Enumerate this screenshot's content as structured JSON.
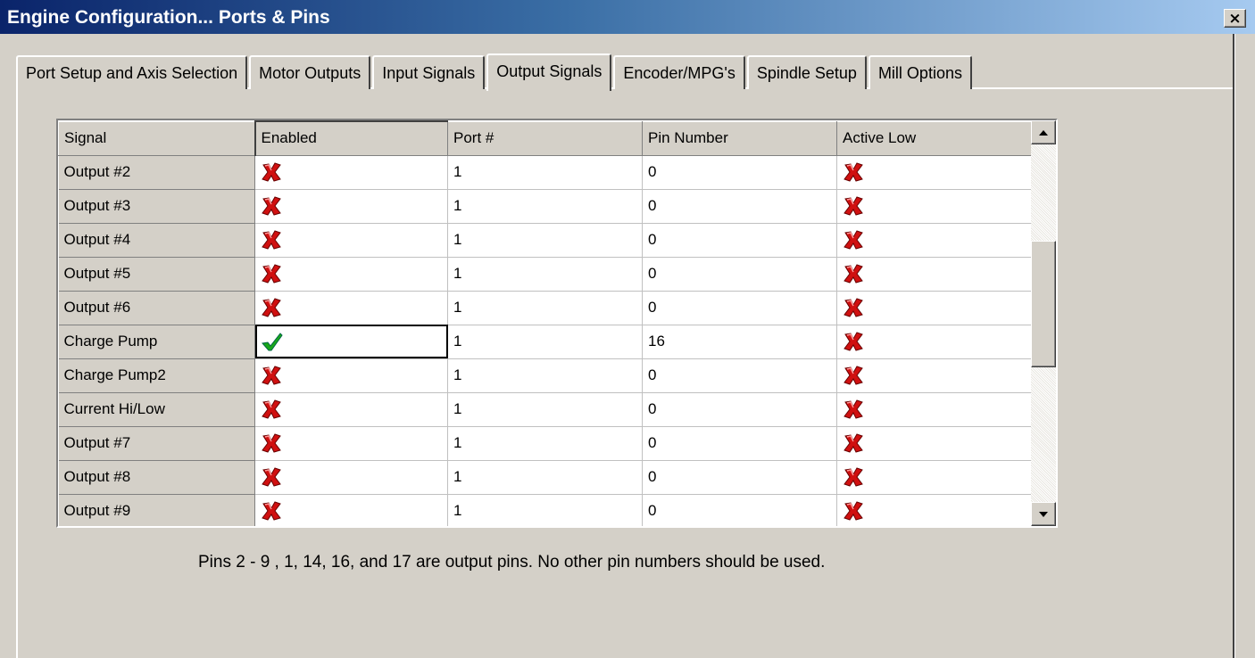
{
  "window": {
    "title": "Engine Configuration... Ports & Pins",
    "close_label": "×"
  },
  "tabs": [
    {
      "label": "Port Setup and Axis Selection",
      "active": false
    },
    {
      "label": "Motor Outputs",
      "active": false
    },
    {
      "label": "Input Signals",
      "active": false
    },
    {
      "label": "Output Signals",
      "active": true
    },
    {
      "label": "Encoder/MPG's",
      "active": false
    },
    {
      "label": "Spindle Setup",
      "active": false
    },
    {
      "label": "Mill Options",
      "active": false
    }
  ],
  "grid": {
    "columns": [
      "Signal",
      "Enabled",
      "Port #",
      "Pin Number",
      "Active Low"
    ],
    "rows": [
      {
        "signal": "Output #2",
        "enabled": false,
        "port": "1",
        "pin": "0",
        "active_low": false
      },
      {
        "signal": "Output #3",
        "enabled": false,
        "port": "1",
        "pin": "0",
        "active_low": false
      },
      {
        "signal": "Output #4",
        "enabled": false,
        "port": "1",
        "pin": "0",
        "active_low": false
      },
      {
        "signal": "Output #5",
        "enabled": false,
        "port": "1",
        "pin": "0",
        "active_low": false
      },
      {
        "signal": "Output #6",
        "enabled": false,
        "port": "1",
        "pin": "0",
        "active_low": false
      },
      {
        "signal": "Charge Pump",
        "enabled": true,
        "port": "1",
        "pin": "16",
        "active_low": false
      },
      {
        "signal": "Charge Pump2",
        "enabled": false,
        "port": "1",
        "pin": "0",
        "active_low": false
      },
      {
        "signal": "Current Hi/Low",
        "enabled": false,
        "port": "1",
        "pin": "0",
        "active_low": false
      },
      {
        "signal": "Output #7",
        "enabled": false,
        "port": "1",
        "pin": "0",
        "active_low": false
      },
      {
        "signal": "Output #8",
        "enabled": false,
        "port": "1",
        "pin": "0",
        "active_low": false
      },
      {
        "signal": "Output #9",
        "enabled": false,
        "port": "1",
        "pin": "0",
        "active_low": false
      }
    ]
  },
  "note": "Pins 2 - 9 , 1, 14, 16, and 17 are output pins. No  other pin numbers should be used.",
  "icons": {
    "disabled": "red-x-icon",
    "enabled": "green-check-icon"
  },
  "colors": {
    "x_red": "#d01010",
    "check_green": "#1aa81a",
    "titlebar": "#0a246a"
  }
}
